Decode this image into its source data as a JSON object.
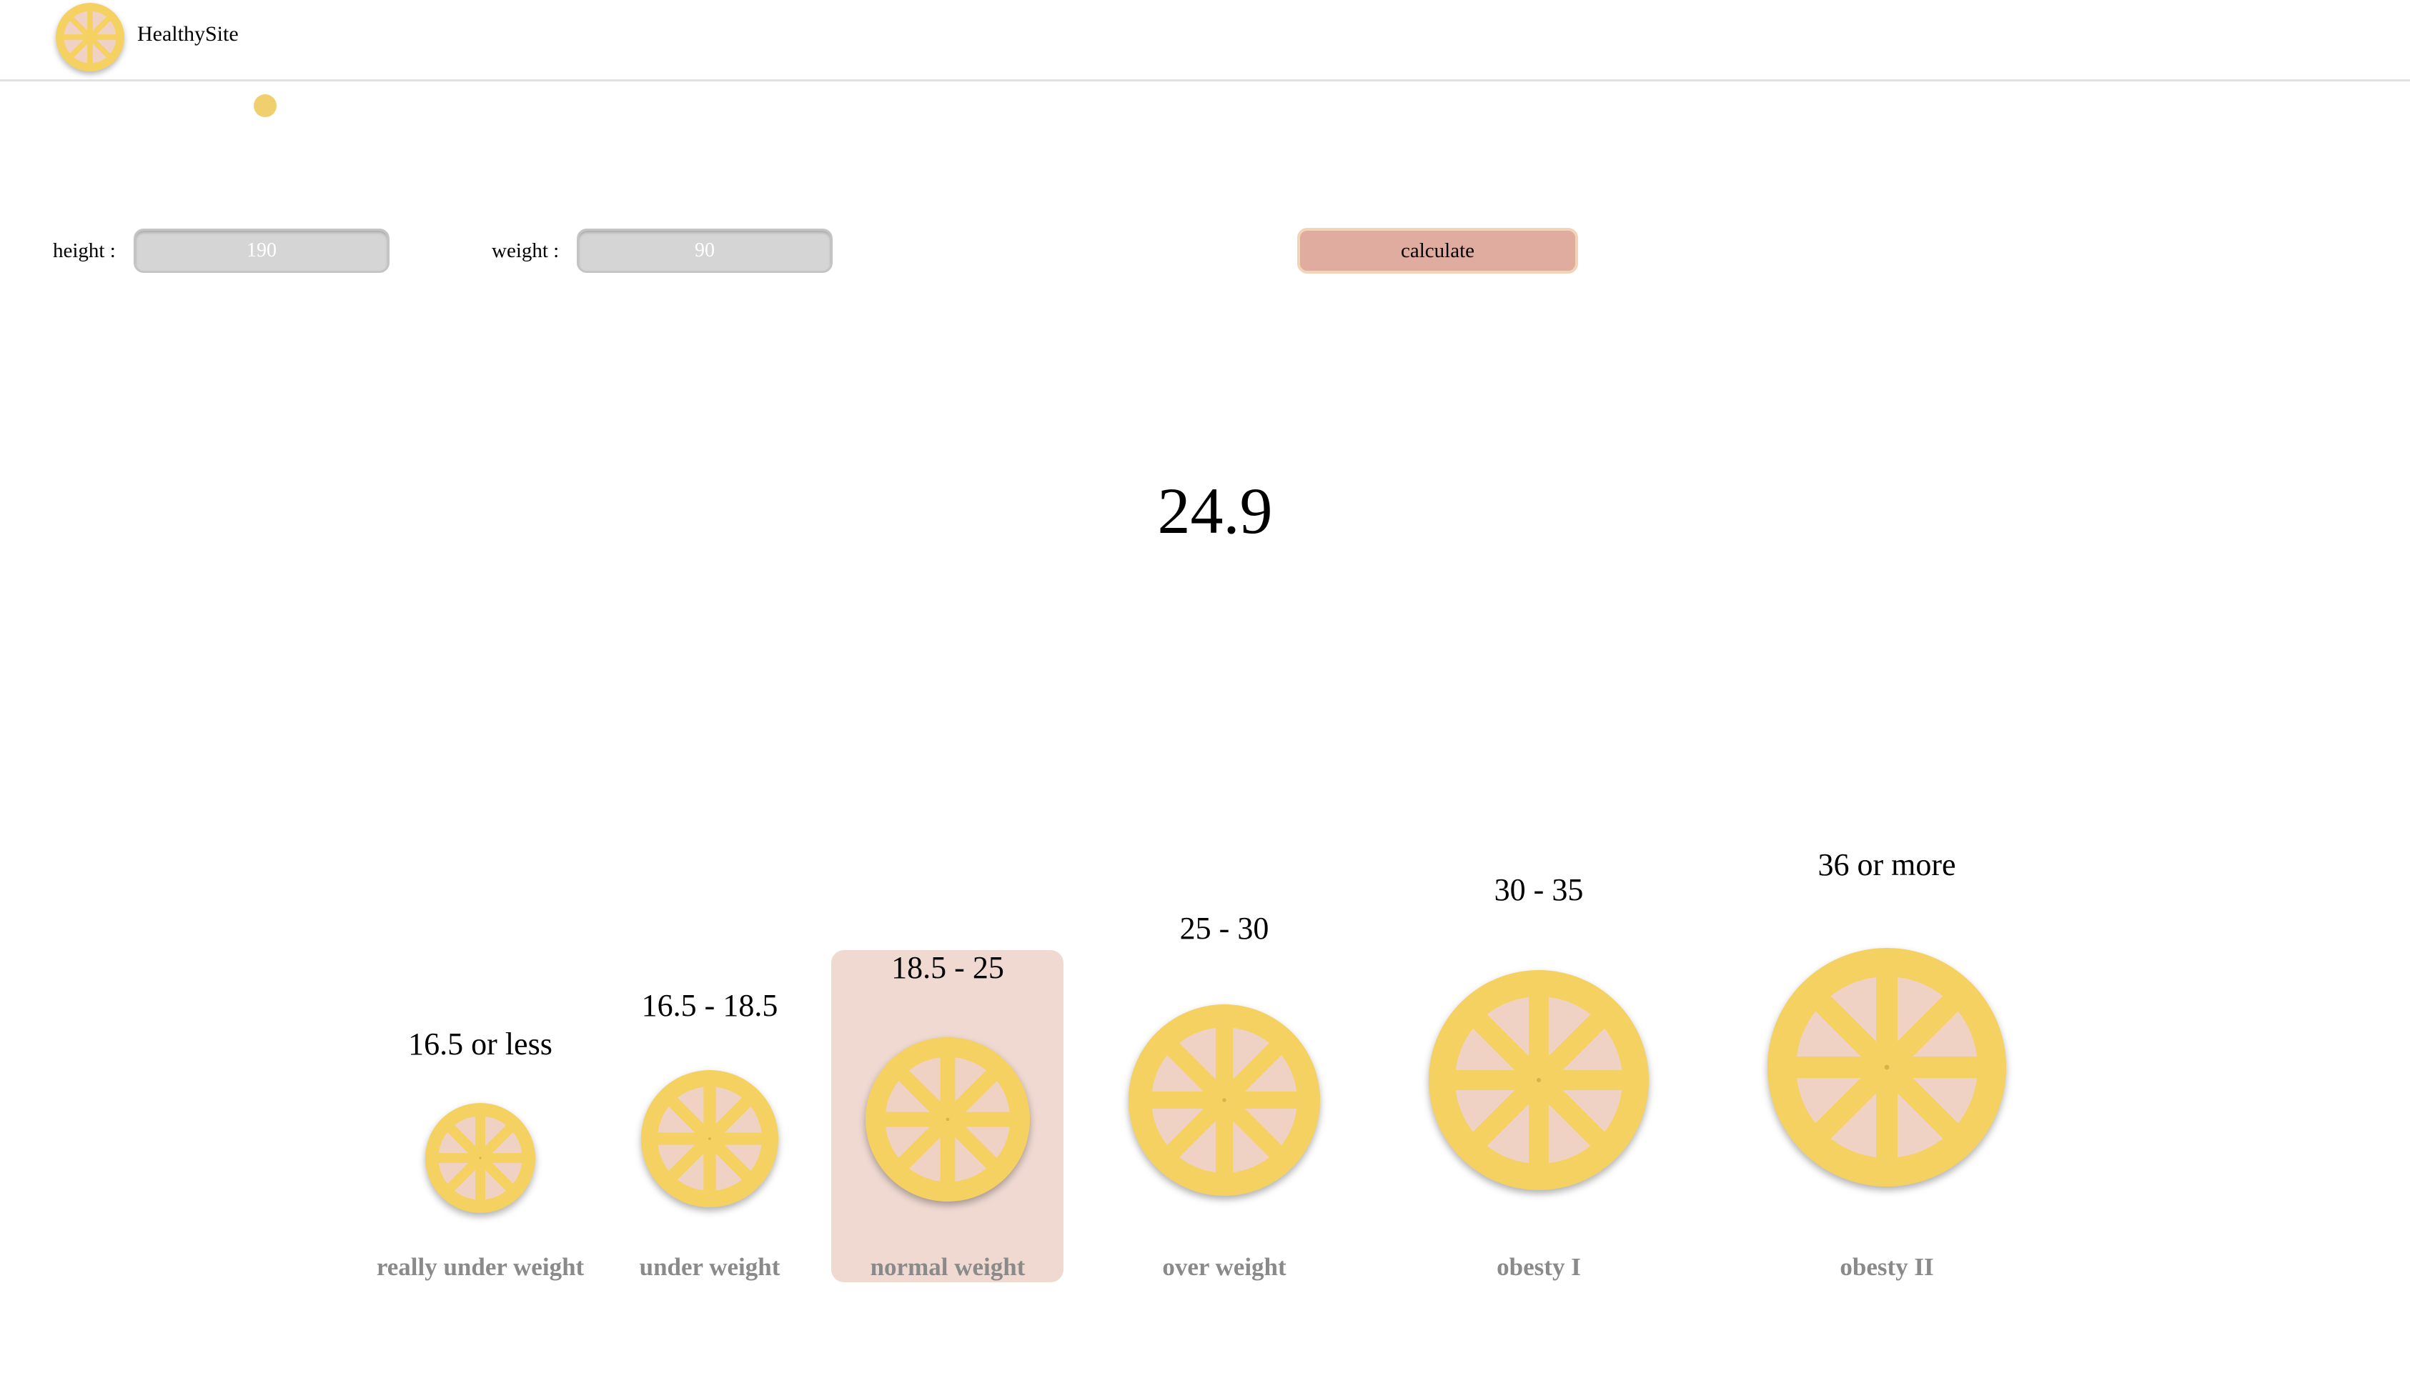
{
  "header": {
    "brand": "HealthySite",
    "logo_icon": "lemon-slice-icon"
  },
  "form": {
    "height_label": "height :",
    "height_value": "190",
    "weight_label": "weight :",
    "weight_value": "90",
    "calculate_label": "calculate"
  },
  "result": {
    "bmi": "24.9"
  },
  "categories": [
    {
      "range": "16.5 or less",
      "label": "really under weight",
      "icon": "lemon-slice-icon"
    },
    {
      "range": "16.5 - 18.5",
      "label": "under weight",
      "icon": "lemon-slice-icon"
    },
    {
      "range": "18.5 - 25",
      "label": "normal weight",
      "icon": "lemon-slice-icon",
      "selected": true
    },
    {
      "range": "25 - 30",
      "label": "over weight",
      "icon": "lemon-slice-icon"
    },
    {
      "range": "30 - 35",
      "label": "obesty I",
      "icon": "lemon-slice-icon"
    },
    {
      "range": "36 or more",
      "label": "obesty II",
      "icon": "lemon-slice-icon"
    }
  ],
  "colors": {
    "lemon": "#f4d160",
    "lemon_pulp": "#efd2c4",
    "highlight": "#efd9d1",
    "button": "#dfac9f",
    "button_border": "#f4d3b6",
    "field": "#d5d5d5",
    "category_label": "#8a8a8a"
  }
}
